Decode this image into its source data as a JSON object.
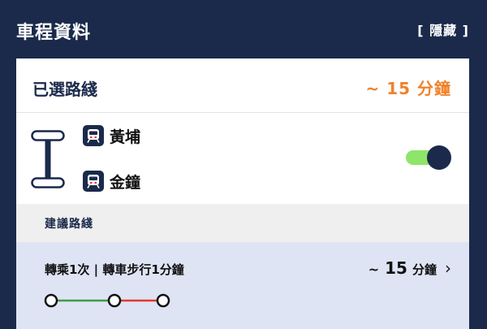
{
  "header": {
    "title": "車程資料",
    "hide_label": "[ 隱藏 ]"
  },
  "selected_route": {
    "label": "已選路綫",
    "duration": "~ 15 分鐘",
    "origin": "黃埔",
    "destination": "金鐘",
    "station_icon": "mtr-logo-icon",
    "toggle_on": true
  },
  "suggested": {
    "label": "建議路綫",
    "options": [
      {
        "summary": "轉乘1次 | 轉車步行1分鐘",
        "approx": "~",
        "minutes": "15",
        "unit": "分鐘",
        "segment_colors": [
          "#3f9b46",
          "#e2392e"
        ]
      }
    ]
  },
  "colors": {
    "navy": "#1b2a4b",
    "accent_orange": "#f0822b",
    "toggle_track": "#8ee56a",
    "option_bg": "#dfe4f4"
  }
}
